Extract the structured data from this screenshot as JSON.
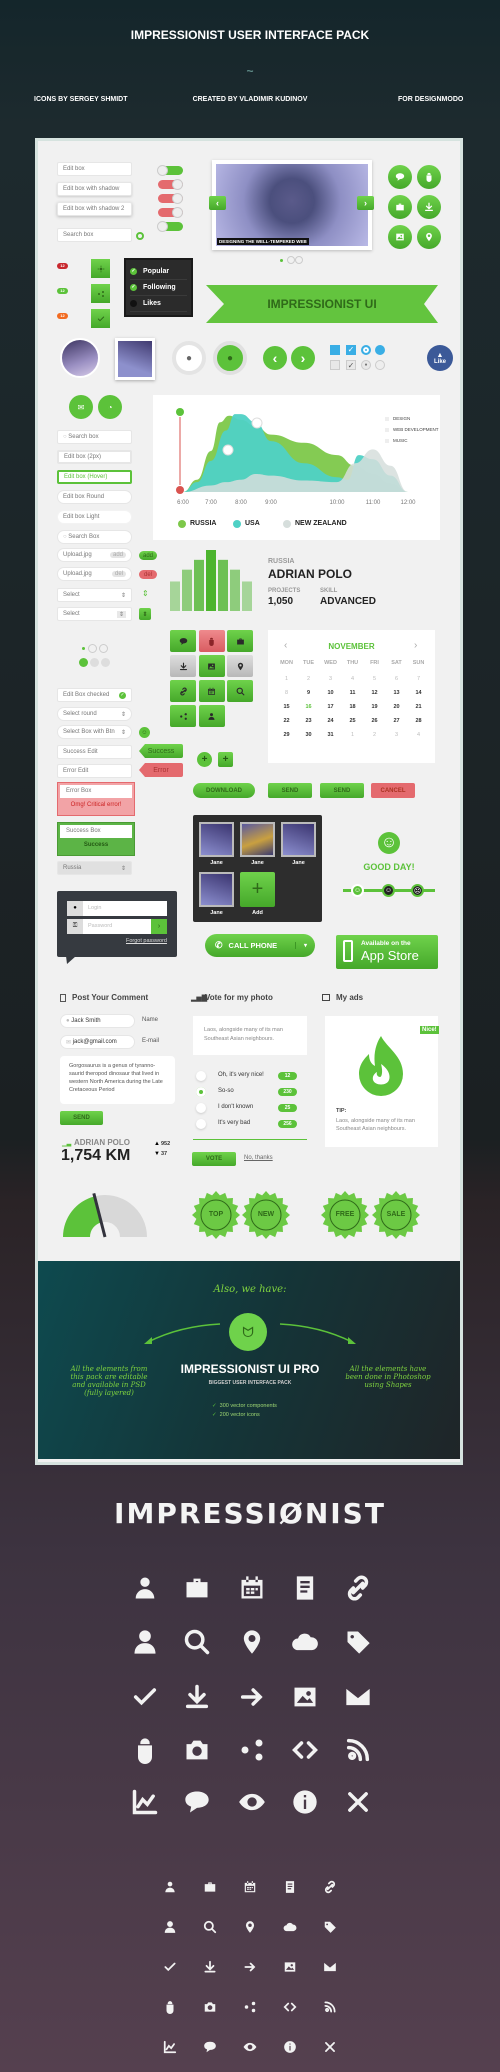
{
  "header": {
    "title": "IMPRESSIONIST USER INTERFACE PACK",
    "ornament": "~",
    "credits": [
      "ICONS BY SERGEY SHMIDT",
      "CREATED BY VLADIMIR KUDINOV",
      "FOR DESIGNMODO"
    ]
  },
  "colors": {
    "green": "#5cc23a",
    "red": "#e46a6e",
    "teal": "#4fd1c5",
    "dark": "#2d2d2d"
  },
  "edit_boxes": [
    "Edit box",
    "Edit box with shadow",
    "Edit box with shadow 2"
  ],
  "search_placeholder": "Search box",
  "toggles": [
    true,
    false,
    false,
    false,
    true
  ],
  "slider": {
    "caption": "DESIGNING THE WELL-TEMPERED WEB",
    "active_dot": 0,
    "dot_count": 3
  },
  "round_icon_buttons": [
    "chat",
    "bug",
    "briefcase",
    "download",
    "image",
    "pin"
  ],
  "badges": [
    {
      "text": "12",
      "color": "#c8282e"
    },
    {
      "text": "12",
      "color": "#5cc23a"
    },
    {
      "text": "12",
      "color": "#f26b21"
    }
  ],
  "square_buttons": [
    "gear",
    "share",
    "check"
  ],
  "dropdown": [
    {
      "label": "Popular",
      "checked": true
    },
    {
      "label": "Following",
      "checked": true
    },
    {
      "label": "Likes",
      "checked": false
    }
  ],
  "ribbon": "IMPRESSIONIST UI",
  "like": "Like",
  "inputs": {
    "search1": "Search box",
    "edit2px": "Edit box (2px)",
    "hover": "Edit box (Hover)",
    "round": "Edit box Round",
    "light": "Edit box Light",
    "search2": "Search Box",
    "upload1": "Upload.jpg",
    "add": "add",
    "upload2": "Upload.jpg",
    "del": "del",
    "select1": "Select",
    "select2": "Select"
  },
  "chart_data": [
    {
      "type": "area",
      "x_ticks": [
        "6:00",
        "7:00",
        "8:00",
        "9:00",
        "10:00",
        "11:00",
        "12:00"
      ],
      "legend": [
        "RUSSIA",
        "USA",
        "NEW ZEALAND"
      ],
      "legend_top": [
        "DESIGN",
        "WEB DEVELOPMENT",
        "MUSIC"
      ],
      "series": [
        {
          "name": "RUSSIA",
          "color": "#7dc84a",
          "points": [
            [
              6,
              0
            ],
            [
              6.5,
              15
            ],
            [
              7,
              50
            ],
            [
              7.3,
              85
            ],
            [
              7.6,
              93
            ],
            [
              8,
              88
            ],
            [
              8.5,
              80
            ],
            [
              9,
              70
            ],
            [
              9.5,
              60
            ],
            [
              10,
              45
            ],
            [
              10.5,
              32
            ],
            [
              11,
              22
            ],
            [
              11.5,
              10
            ],
            [
              12,
              0
            ]
          ]
        },
        {
          "name": "USA",
          "color": "#4fd1c5",
          "points": [
            [
              6,
              0
            ],
            [
              6.5,
              12
            ],
            [
              7,
              38
            ],
            [
              7.5,
              75
            ],
            [
              7.8,
              95
            ],
            [
              8,
              95
            ],
            [
              8.5,
              85
            ],
            [
              9,
              62
            ],
            [
              9.5,
              35
            ],
            [
              10,
              18
            ],
            [
              10.3,
              15
            ],
            [
              10.6,
              45
            ],
            [
              11,
              40
            ],
            [
              11.5,
              20
            ],
            [
              12,
              0
            ]
          ]
        },
        {
          "name": "NEW ZEALAND",
          "color": "#d6dedc",
          "points": [
            [
              6,
              0
            ],
            [
              7,
              8
            ],
            [
              7.5,
              12
            ],
            [
              8,
              15
            ],
            [
              8.5,
              22
            ],
            [
              9,
              20
            ],
            [
              9.5,
              14
            ],
            [
              10,
              12
            ],
            [
              10.5,
              35
            ],
            [
              11,
              52
            ],
            [
              11.5,
              32
            ],
            [
              12,
              0
            ]
          ]
        }
      ]
    },
    {
      "type": "bar",
      "values": [
        30,
        42,
        52,
        62,
        52,
        42,
        30
      ]
    }
  ],
  "profile": {
    "country": "RUSSIA",
    "name": "ADRIAN POLO",
    "projects_label": "PROJECTS",
    "projects": "1,050",
    "skill_label": "SKILL",
    "skill": "ADVANCED"
  },
  "icon_grid": [
    {
      "icon": "chat",
      "c": "g"
    },
    {
      "icon": "bug",
      "c": "r"
    },
    {
      "icon": "briefcase",
      "c": "g"
    },
    {
      "icon": "download",
      "c": "s"
    },
    {
      "icon": "image",
      "c": "g"
    },
    {
      "icon": "pin",
      "c": "s"
    },
    {
      "icon": "link",
      "c": "g"
    },
    {
      "icon": "calendar",
      "c": "g"
    },
    {
      "icon": "search",
      "c": "g"
    },
    {
      "icon": "share",
      "c": "g"
    },
    {
      "icon": "user",
      "c": "g"
    }
  ],
  "calendar": {
    "month": "NOVEMBER",
    "weekdays": [
      "MON",
      "TUE",
      "WED",
      "THU",
      "FRI",
      "SAT",
      "SUN"
    ],
    "days": [
      "1",
      "2",
      "3",
      "4",
      "5",
      "6",
      "7",
      "8",
      "9",
      "10",
      "11",
      "12",
      "13",
      "14",
      "15",
      "16",
      "17",
      "18",
      "19",
      "20",
      "21",
      "22",
      "23",
      "24",
      "25",
      "26",
      "27",
      "28",
      "29",
      "30",
      "31",
      "1",
      "2",
      "3",
      "4"
    ],
    "today": "16"
  },
  "forms": {
    "checked": "Edit Box checked",
    "select_round": "Select  round",
    "select_btn": "Select Box with Btn",
    "success_edit": "Success Edit",
    "error_edit": "Error Edit",
    "success_tag": "Success",
    "error_tag": "Error",
    "error_box": "Error Box",
    "error_msg": "Omg! Critical error!",
    "success_box": "Success Box",
    "success_msg": "Success",
    "country": "Russia"
  },
  "buttons": {
    "download": "DOWNLOAD",
    "send1": "SEND",
    "send2": "SEND",
    "cancel": "CANCEL",
    "call": "CALL PHONE",
    "appstore_small": "Available on the",
    "appstore_big": "App Store"
  },
  "gallery": [
    "Jane",
    "Jane",
    "Jane",
    "Jane"
  ],
  "gallery_add": "Add",
  "mood": {
    "text": "GOOD DAY!",
    "level": 0
  },
  "login": {
    "login_placeholder": "Login",
    "password_placeholder": "Password",
    "forgot": "Forgot password"
  },
  "comment": {
    "title": "Post Your Comment",
    "name": "Jack Smith",
    "name_label": "Name",
    "email": "jack@gmail.com",
    "email_label": "E-mail",
    "message": "Gorgosaurus is a genus of tyranno-saurid theropod dinosaur that lived in western North America during the Late Cretaceous Period",
    "send": "SEND",
    "stat_name": "ADRIAN POLO",
    "stat_value": "1,754 KM",
    "likes": "952",
    "dislikes": "37"
  },
  "vote": {
    "title": "Vote for my photo",
    "text": "Laos, alongside many of its man Southeast Asian neighbours.",
    "options": [
      {
        "label": "Oh, it's very nice!",
        "count": "12"
      },
      {
        "label": "So-so",
        "count": "230",
        "selected": true
      },
      {
        "label": "I don't known",
        "count": "25"
      },
      {
        "label": "It's very bad",
        "count": "256"
      }
    ],
    "vote": "VOTE",
    "no": "No, thanks"
  },
  "ads": {
    "title": "My ads",
    "tag": "Nice!",
    "tip": "TIP:",
    "text": "Laos, alongside many of its man Southeast Asian neighbours."
  },
  "gauge": {
    "value": 0.42
  },
  "badges_round": [
    "TOP",
    "NEW",
    "FREE",
    "SALE"
  ],
  "promo": {
    "also": "Also, we have:",
    "title": "IMPRESSIONIST UI PRO",
    "subtitle": "BIGGEST USER INTERFACE PACK",
    "features": [
      "300 vector components",
      "200 vector icons"
    ],
    "left": "All the elements from this pack are editable and available in PSD (fully layered)",
    "right": "All the elements have been done in Photoshop using Shapes"
  },
  "icons": {
    "title": "IMPRESSIØNIST",
    "set": [
      "user",
      "briefcase",
      "calendar",
      "document",
      "link",
      "user-alt",
      "search",
      "pin",
      "cloud",
      "tag",
      "check",
      "download",
      "arrow-right",
      "image",
      "mail",
      "bug",
      "camera",
      "share",
      "code",
      "rss",
      "chart",
      "chat",
      "eye",
      "info",
      "close"
    ]
  }
}
